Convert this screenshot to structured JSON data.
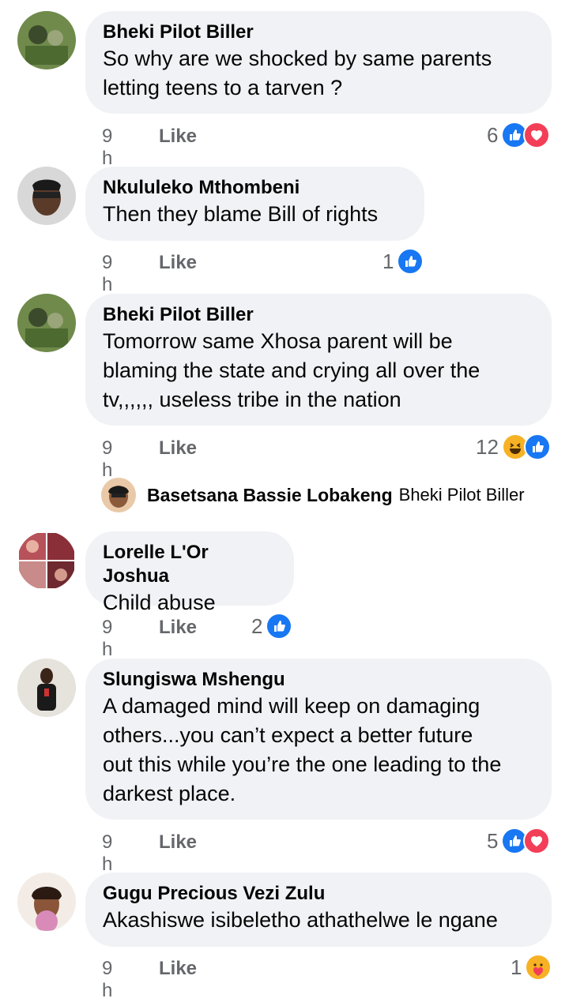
{
  "comments": [
    {
      "author": "Bheki Pilot Biller",
      "lines": [
        "So why are we shocked by same parents",
        "letting teens to a tarven ?"
      ],
      "time": "9 h",
      "like": "Like",
      "reactions_count": "6",
      "reactions": [
        "like-icon",
        "love-icon"
      ]
    },
    {
      "author": "Nkululeko Mthombeni",
      "lines": [
        "Then they blame Bill of rights"
      ],
      "time": "9 h",
      "like": "Like",
      "reactions_count": "1",
      "reactions": [
        "like-icon"
      ]
    },
    {
      "author": "Bheki Pilot Biller",
      "lines": [
        "Tomorrow same Xhosa parent will be",
        "blaming the state and crying all over the",
        "tv,,,,,, useless tribe in the nation"
      ],
      "time": "9 h",
      "like": "Like",
      "reactions_count": "12",
      "reactions": [
        "haha-icon",
        "like-icon"
      ]
    },
    {
      "author": "Lorelle L'Or Joshua",
      "lines": [
        "Child abuse"
      ],
      "time": "9 h",
      "like": "Like",
      "reactions_count": "2",
      "reactions": [
        "like-icon"
      ]
    },
    {
      "author": "Slungiswa Mshengu",
      "lines": [
        "A damaged mind will keep on damaging",
        "others...you can’t expect a better future",
        "out this while you’re the one leading to the",
        "darkest place."
      ],
      "time": "9 h",
      "like": "Like",
      "reactions_count": "5",
      "reactions": [
        "like-icon",
        "love-icon"
      ]
    },
    {
      "author": "Gugu Precious Vezi Zulu",
      "lines": [
        "Akashiswe isibeletho athathelwe le ngane"
      ],
      "time": "9 h",
      "like": "Like",
      "reactions_count": "1",
      "reactions": [
        "care-icon"
      ]
    }
  ],
  "reply": {
    "author": "Basetsana Bassie Lobakeng",
    "target": "Bheki Pilot Biller"
  },
  "colors": {
    "bubble": "#f0f2f5",
    "like_blue": "#1877f2",
    "love_red": "#f33e58",
    "haha_yellow": "#f7b125",
    "meta_gray": "#65676b"
  }
}
